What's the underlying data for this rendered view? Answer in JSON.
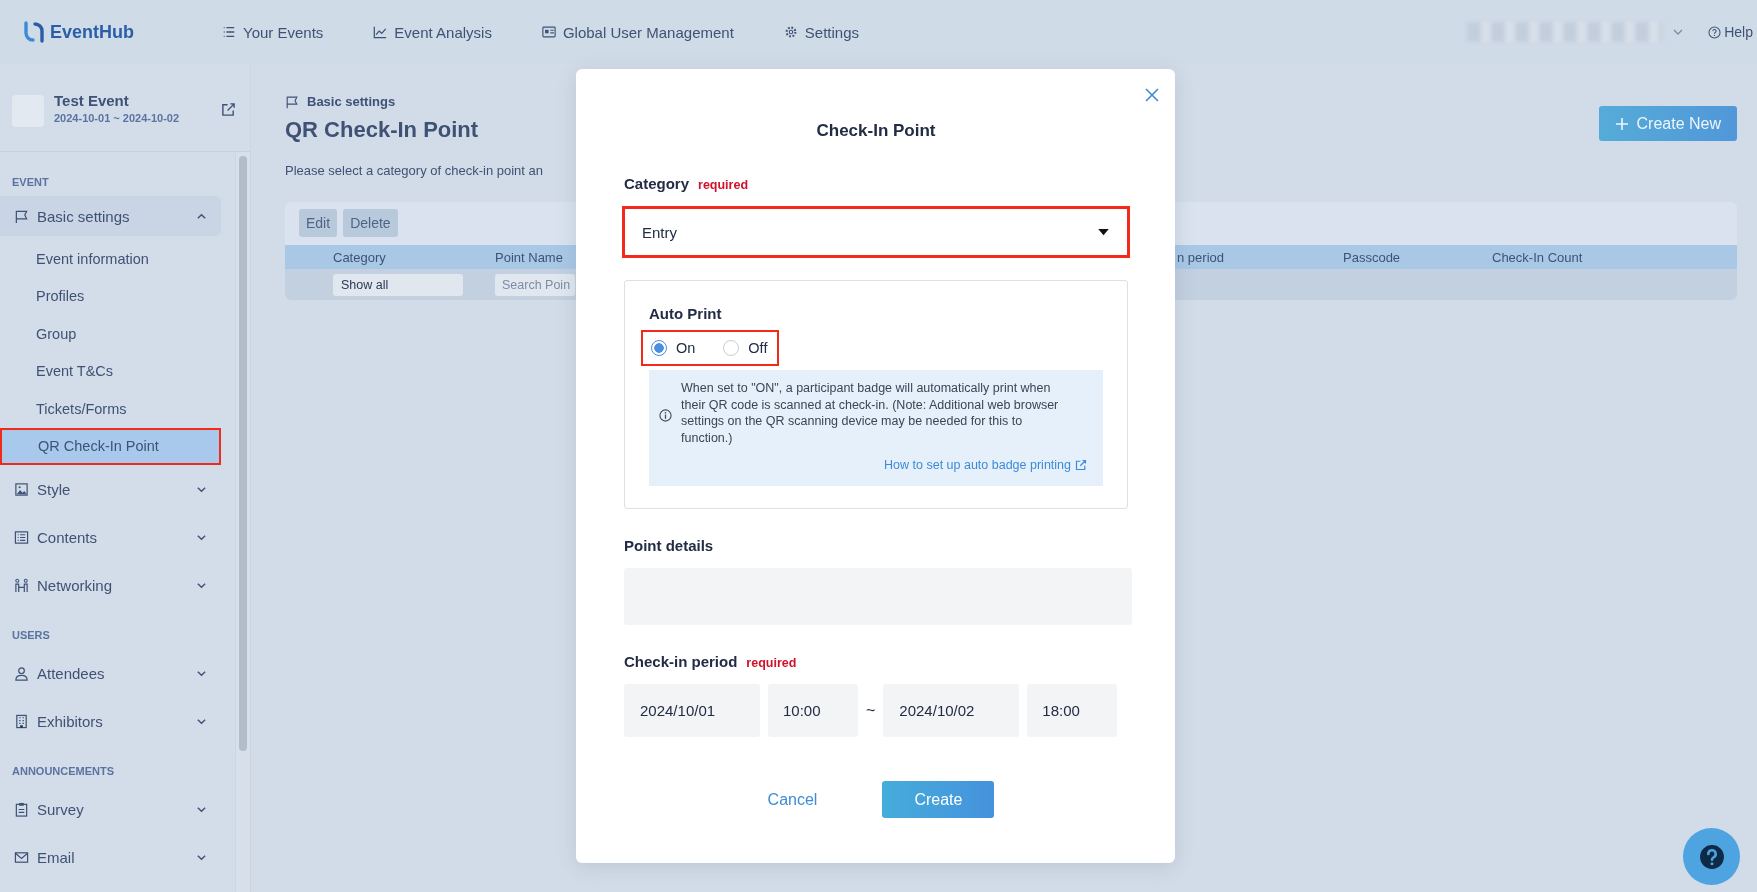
{
  "top_nav": {
    "logo": "EventHub",
    "items": [
      {
        "label": "Your Events",
        "selected": false
      },
      {
        "label": "Event Analysis",
        "selected": false
      },
      {
        "label": "Global User Management",
        "selected": false
      },
      {
        "label": "Settings",
        "selected": false
      }
    ],
    "help": "Help"
  },
  "event": {
    "name": "Test Event",
    "dates": "2024-10-01 ~ 2024-10-02"
  },
  "sidebar": {
    "sections": [
      {
        "heading": "EVENT",
        "items": [
          {
            "label": "Basic settings",
            "expanded": true,
            "children": [
              {
                "label": "Event information",
                "selected": false,
                "highlighted": false
              },
              {
                "label": "Profiles",
                "selected": false,
                "highlighted": false
              },
              {
                "label": "Group",
                "selected": false,
                "highlighted": false
              },
              {
                "label": "Event T&Cs",
                "selected": false,
                "highlighted": false
              },
              {
                "label": "Tickets/Forms",
                "selected": false,
                "highlighted": false
              },
              {
                "label": "QR Check-In Point",
                "selected": true,
                "highlighted": true
              }
            ]
          },
          {
            "label": "Style",
            "expanded": false
          },
          {
            "label": "Contents",
            "expanded": false
          },
          {
            "label": "Networking",
            "expanded": false
          }
        ]
      },
      {
        "heading": "USERS",
        "items": [
          {
            "label": "Attendees",
            "expanded": false
          },
          {
            "label": "Exhibitors",
            "expanded": false
          }
        ]
      },
      {
        "heading": "ANNOUNCEMENTS",
        "items": [
          {
            "label": "Survey",
            "expanded": false
          },
          {
            "label": "Email",
            "expanded": false
          }
        ]
      }
    ]
  },
  "page": {
    "breadcrumb": "Basic settings",
    "title": "QR Check-In Point",
    "description": "Please select a category of check-in point an",
    "create_button": "Create New"
  },
  "table": {
    "toolbar": [
      {
        "label": "Edit",
        "disabled": true
      },
      {
        "label": "Delete",
        "disabled": true
      }
    ],
    "columns": [
      "Category",
      "Point Name",
      "n period",
      "Passcode",
      "Check-In Count"
    ],
    "filters": {
      "category": "Show all",
      "search_placeholder": "Search Poin"
    }
  },
  "dialog": {
    "title": "Check-In Point",
    "category": {
      "label": "Category",
      "required": "required",
      "value": "Entry",
      "highlighted": true
    },
    "auto_print": {
      "label": "Auto Print",
      "highlighted": true,
      "options": [
        {
          "label": "On",
          "selected": true
        },
        {
          "label": "Off",
          "selected": false
        }
      ],
      "info": "When set to \"ON\", a participant badge will automatically print when their QR code is scanned at check-in. (Note: Additional web browser settings on the QR scanning device may be needed for this to function.)",
      "link": "How to set up auto badge printing"
    },
    "point_details": {
      "label": "Point details"
    },
    "check_in_period": {
      "label": "Check-in period",
      "required": "required",
      "start_date": "2024/10/01",
      "start_time": "10:00",
      "separator": "~",
      "end_date": "2024/10/02",
      "end_time": "18:00"
    },
    "buttons": {
      "cancel": "Cancel",
      "create": "Create"
    }
  }
}
